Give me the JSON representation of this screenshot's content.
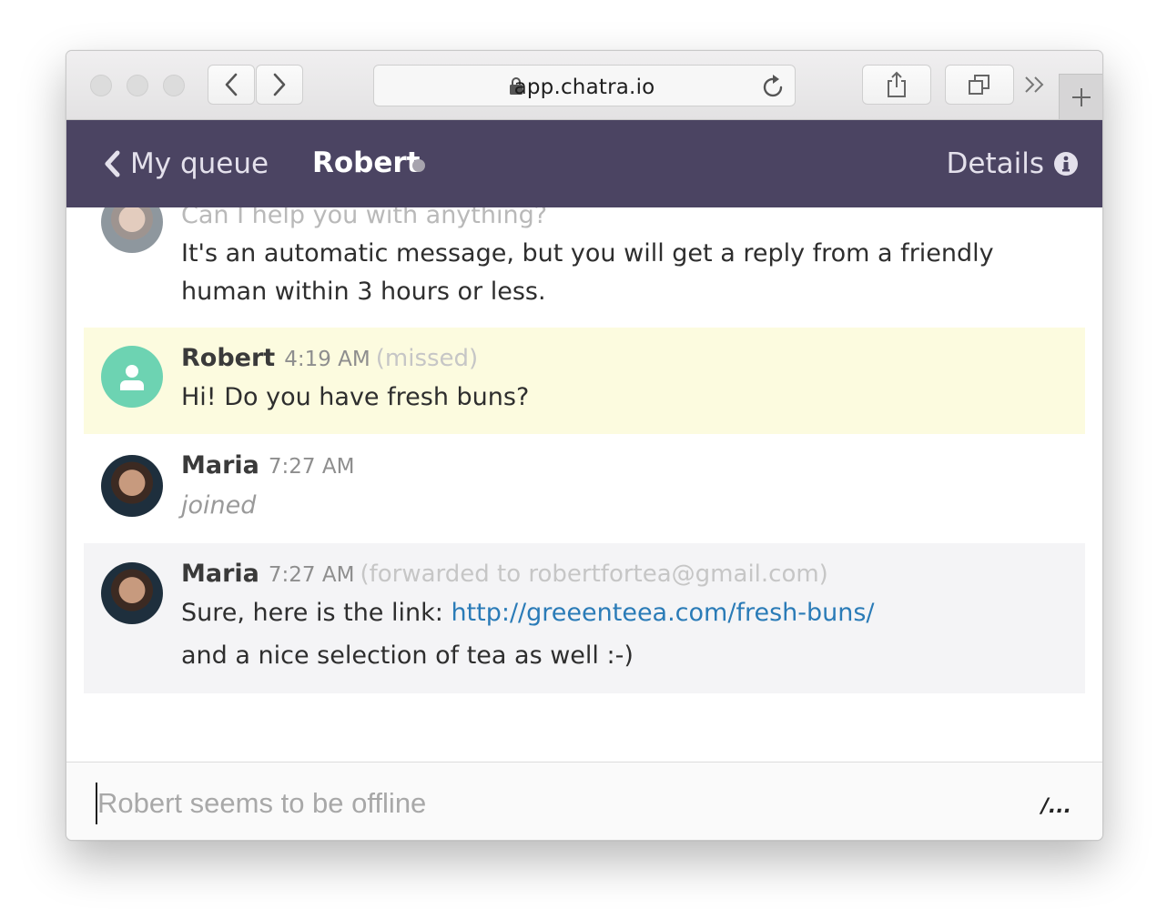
{
  "browser": {
    "url": "app.chatra.io",
    "colors": {
      "toolbar": "#e8e7e8"
    }
  },
  "header": {
    "back_label": "My queue",
    "conversation_name": "Robert",
    "details_label": "Details",
    "colors": {
      "background": "#4b4462",
      "status_offline": "#a7a4ae"
    }
  },
  "messages": [
    {
      "kind": "bot",
      "partial_text": "Can I help you with anything?",
      "text": "It's an automatic message, but you will get a reply from a friendly human within 3 hours or less."
    },
    {
      "kind": "visitor",
      "author": "Robert",
      "time": "4:19 AM",
      "note": "(missed)",
      "text": "Hi! Do you have fresh buns?",
      "highlight": "#fcfbdf",
      "avatar_color": "#6dd3b2"
    },
    {
      "kind": "event",
      "author": "Maria",
      "time": "7:27 AM",
      "text": "joined"
    },
    {
      "kind": "agent",
      "author": "Maria",
      "time": "7:27 AM",
      "note": "(forwarded to robertfortea@gmail.com)",
      "text_prefix": "Sure, here is the link: ",
      "link": "http://greeenteea.com/fresh-buns/",
      "text2": "and a nice selection of tea as well :-)",
      "highlight": "#f4f4f6",
      "link_color": "#2a7bb7"
    }
  ],
  "composer": {
    "placeholder": "Robert seems to be offline",
    "value": "",
    "shortcut_hint": "/..."
  }
}
